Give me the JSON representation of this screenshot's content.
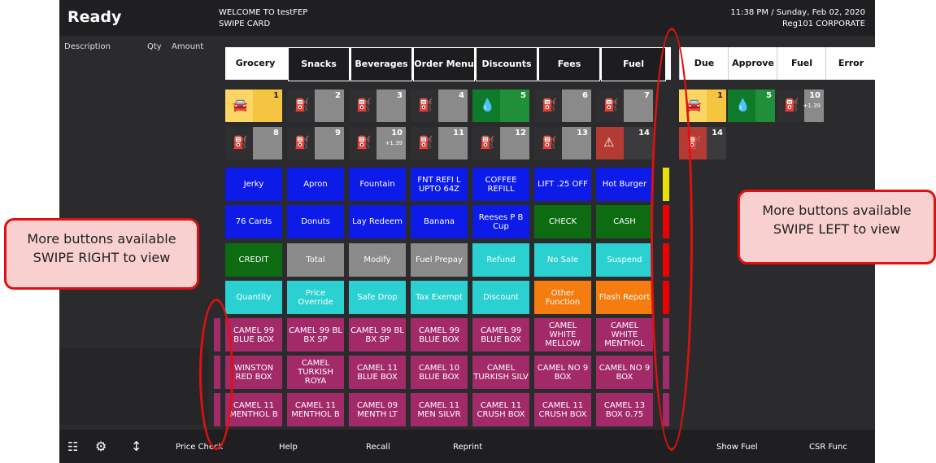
{
  "status": "Ready",
  "header": {
    "welcome": "WELCOME TO testFEP",
    "prompt": "SWIPE CARD",
    "time": "11:38 PM",
    "date": "/ Sunday, Feb 02, 2020",
    "register": "Reg101  CORPORATE"
  },
  "receipt": {
    "description": "Description",
    "qty": "Qty",
    "amount": "Amount"
  },
  "tabs": [
    "Grocery",
    "Snacks",
    "Beverages",
    "Order Menu",
    "Discounts",
    "Fees",
    "Fuel"
  ],
  "pumps": [
    {
      "num": "1",
      "style": "yel",
      "icon": "car-icon"
    },
    {
      "num": "2",
      "style": "gray",
      "icon": "fuel-pump-icon"
    },
    {
      "num": "3",
      "style": "gray",
      "icon": "fuel-pump-icon"
    },
    {
      "num": "4",
      "style": "gray",
      "icon": "fuel-pump-icon"
    },
    {
      "num": "5",
      "style": "grn",
      "icon": "fuel-drop-icon"
    },
    {
      "num": "6",
      "style": "gray",
      "icon": "fuel-pump-icon"
    },
    {
      "num": "7",
      "style": "gray",
      "icon": "fuel-pump-icon"
    },
    {
      "num": "8",
      "style": "gray",
      "icon": "fuel-pump-icon"
    },
    {
      "num": "9",
      "style": "gray",
      "icon": "fuel-pump-icon"
    },
    {
      "num": "10",
      "ppg": "+1.39",
      "style": "gray",
      "icon": "fuel-pump-icon"
    },
    {
      "num": "11",
      "style": "gray",
      "icon": "fuel-pump-icon"
    },
    {
      "num": "12",
      "style": "gray",
      "icon": "fuel-pump-icon"
    },
    {
      "num": "13",
      "style": "gray",
      "icon": "fuel-pump-icon"
    },
    {
      "num": "14",
      "style": "red",
      "icon": "warning-icon"
    }
  ],
  "buttons": [
    [
      {
        "l": "Jerky",
        "c": "blue"
      },
      {
        "l": "Apron",
        "c": "blue"
      },
      {
        "l": "Fountain",
        "c": "blue"
      },
      {
        "l": "FNT REFI L UPTO 64Z",
        "c": "blue"
      },
      {
        "l": "COFFEE REFILL",
        "c": "blue"
      },
      {
        "l": "LIFT .25 OFF",
        "c": "blue"
      },
      {
        "l": "Hot Burger",
        "c": "blue"
      }
    ],
    [
      {
        "l": "76 Cards",
        "c": "blue"
      },
      {
        "l": "Donuts",
        "c": "blue"
      },
      {
        "l": "Lay Redeem",
        "c": "blue"
      },
      {
        "l": "Banana",
        "c": "blue"
      },
      {
        "l": "Reeses P B Cup",
        "c": "blue"
      },
      {
        "l": "CHECK",
        "c": "green"
      },
      {
        "l": "CASH",
        "c": "green"
      }
    ],
    [
      {
        "l": "CREDIT",
        "c": "green"
      },
      {
        "l": "Total",
        "c": "gray"
      },
      {
        "l": "Modify",
        "c": "gray"
      },
      {
        "l": "Fuel Prepay",
        "c": "gray"
      },
      {
        "l": "Refund",
        "c": "cyan"
      },
      {
        "l": "No Sale",
        "c": "cyan"
      },
      {
        "l": "Suspend",
        "c": "cyan"
      }
    ],
    [
      {
        "l": "Quantity",
        "c": "cyan"
      },
      {
        "l": "Price Override",
        "c": "cyan"
      },
      {
        "l": "Safe Drop",
        "c": "cyan"
      },
      {
        "l": "Tax Exempt",
        "c": "cyan"
      },
      {
        "l": "Discount",
        "c": "cyan"
      },
      {
        "l": "Other Function",
        "c": "orange"
      },
      {
        "l": "Flash Report",
        "c": "orange"
      }
    ],
    [
      {
        "l": "CAMEL 99 BLUE BOX",
        "c": "mag"
      },
      {
        "l": "CAMEL 99 BL BX SP",
        "c": "mag"
      },
      {
        "l": "CAMEL 99 BL BX SP",
        "c": "mag"
      },
      {
        "l": "CAMEL 99 BLUE BOX",
        "c": "mag"
      },
      {
        "l": "CAMEL 99 BLUE BOX",
        "c": "mag"
      },
      {
        "l": "CAMEL WHITE MELLOW",
        "c": "mag"
      },
      {
        "l": "CAMEL WHITE MENTHOL",
        "c": "mag"
      }
    ],
    [
      {
        "l": "WINSTON RED BOX",
        "c": "mag"
      },
      {
        "l": "CAMEL TURKISH ROYA",
        "c": "mag"
      },
      {
        "l": "CAMEL 11 BLUE BOX",
        "c": "mag"
      },
      {
        "l": "CAMEL 10 BLUE BOX",
        "c": "mag"
      },
      {
        "l": "CAMEL TURKISH SILV",
        "c": "mag"
      },
      {
        "l": "CAMEL NO 9 BOX",
        "c": "mag"
      },
      {
        "l": "CAMEL NO 9 BOX",
        "c": "mag"
      }
    ],
    [
      {
        "l": "CAMEL 11 MENTHOL B",
        "c": "mag"
      },
      {
        "l": "CAMEL 11 MENTHOL B",
        "c": "mag"
      },
      {
        "l": "CAMEL 09 MENTH LT",
        "c": "mag"
      },
      {
        "l": "CAMEL 11 MEN SILVR",
        "c": "mag"
      },
      {
        "l": "CAMEL 11 CRUSH BOX",
        "c": "mag"
      },
      {
        "l": "CAMEL 11 CRUSH BOX",
        "c": "mag"
      },
      {
        "l": "CAMEL 13 BOX 0.75",
        "c": "mag"
      }
    ]
  ],
  "right_tabs": [
    "Due",
    "Approve",
    "Fuel",
    "Error"
  ],
  "right_pumps": [
    {
      "num": "1",
      "style": "yel",
      "icon": "car-icon"
    },
    {
      "num": "5",
      "style": "grn",
      "icon": "fuel-drop-icon"
    },
    {
      "num": "10",
      "ppg": "+1.39",
      "style": "gray",
      "icon": "fuel-pump-icon"
    },
    {
      "num": "14",
      "style": "red",
      "icon": "fuel-pump-icon"
    }
  ],
  "bottom": {
    "price_check": "Price Check",
    "help": "Help",
    "recall": "Recall",
    "reprint": "Reprint",
    "show_fuel": "Show Fuel",
    "csr_func": "CSR Func"
  },
  "annotations": {
    "left": "More buttons available SWIPE RIGHT to view",
    "right": "More buttons available SWIPE LEFT to view"
  },
  "colors": {
    "blue": "#0c1be8",
    "green": "#0d6b12",
    "gray": "#8a8a8a",
    "cyan": "#2bd1d1",
    "orange": "#f57c0f",
    "magenta": "#a32a69",
    "callout_border": "#e01010"
  }
}
